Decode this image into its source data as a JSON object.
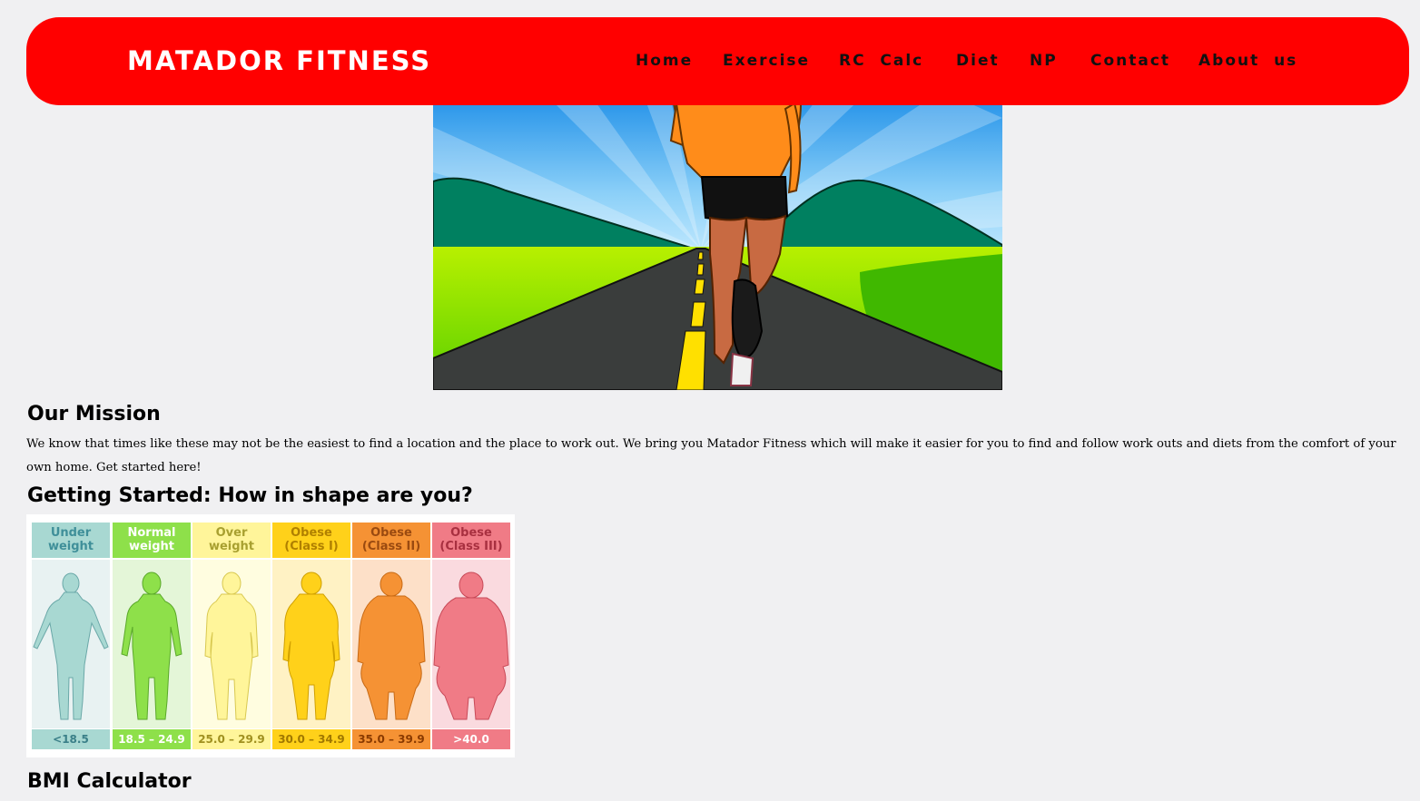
{
  "navbar": {
    "brand": "MATADOR FITNESS",
    "background_color": "#ff0000",
    "links": [
      {
        "label": "Home"
      },
      {
        "label": "Exercise"
      },
      {
        "label": "RC  Calc"
      },
      {
        "label": "Diet"
      },
      {
        "label": "NP"
      },
      {
        "label": "Contact"
      },
      {
        "label": "About  us"
      }
    ]
  },
  "hero": {
    "icon": "runner-on-road-illustration"
  },
  "mission": {
    "heading": "Our Mission",
    "text": "We know that times like these may not be the easiest to find a location and the place to work out. We bring you Matador Fitness which will make it easier for you to find and follow work outs and diets from the comfort of your own home. Get started here!"
  },
  "getting_started": {
    "heading": "Getting Started: How in shape are you?"
  },
  "bmi_chart": {
    "categories": [
      {
        "line1": "Under",
        "line2": "weight",
        "range": "<18.5",
        "color": "#a8d8d2"
      },
      {
        "line1": "Normal",
        "line2": "weight",
        "range": "18.5 – 24.9",
        "color": "#8ee04a"
      },
      {
        "line1": "Over",
        "line2": "weight",
        "range": "25.0 – 29.9",
        "color": "#fff59a"
      },
      {
        "line1": "Obese",
        "line2": "(Class I)",
        "range": "30.0 – 34.9",
        "color": "#ffd11a"
      },
      {
        "line1": "Obese",
        "line2": "(Class II)",
        "range": "35.0 – 39.9",
        "color": "#f59234"
      },
      {
        "line1": "Obese",
        "line2": "(Class III)",
        "range": ">40.0",
        "color": "#f07b86"
      }
    ]
  },
  "bmi_calculator": {
    "heading": "BMI Calculator"
  }
}
